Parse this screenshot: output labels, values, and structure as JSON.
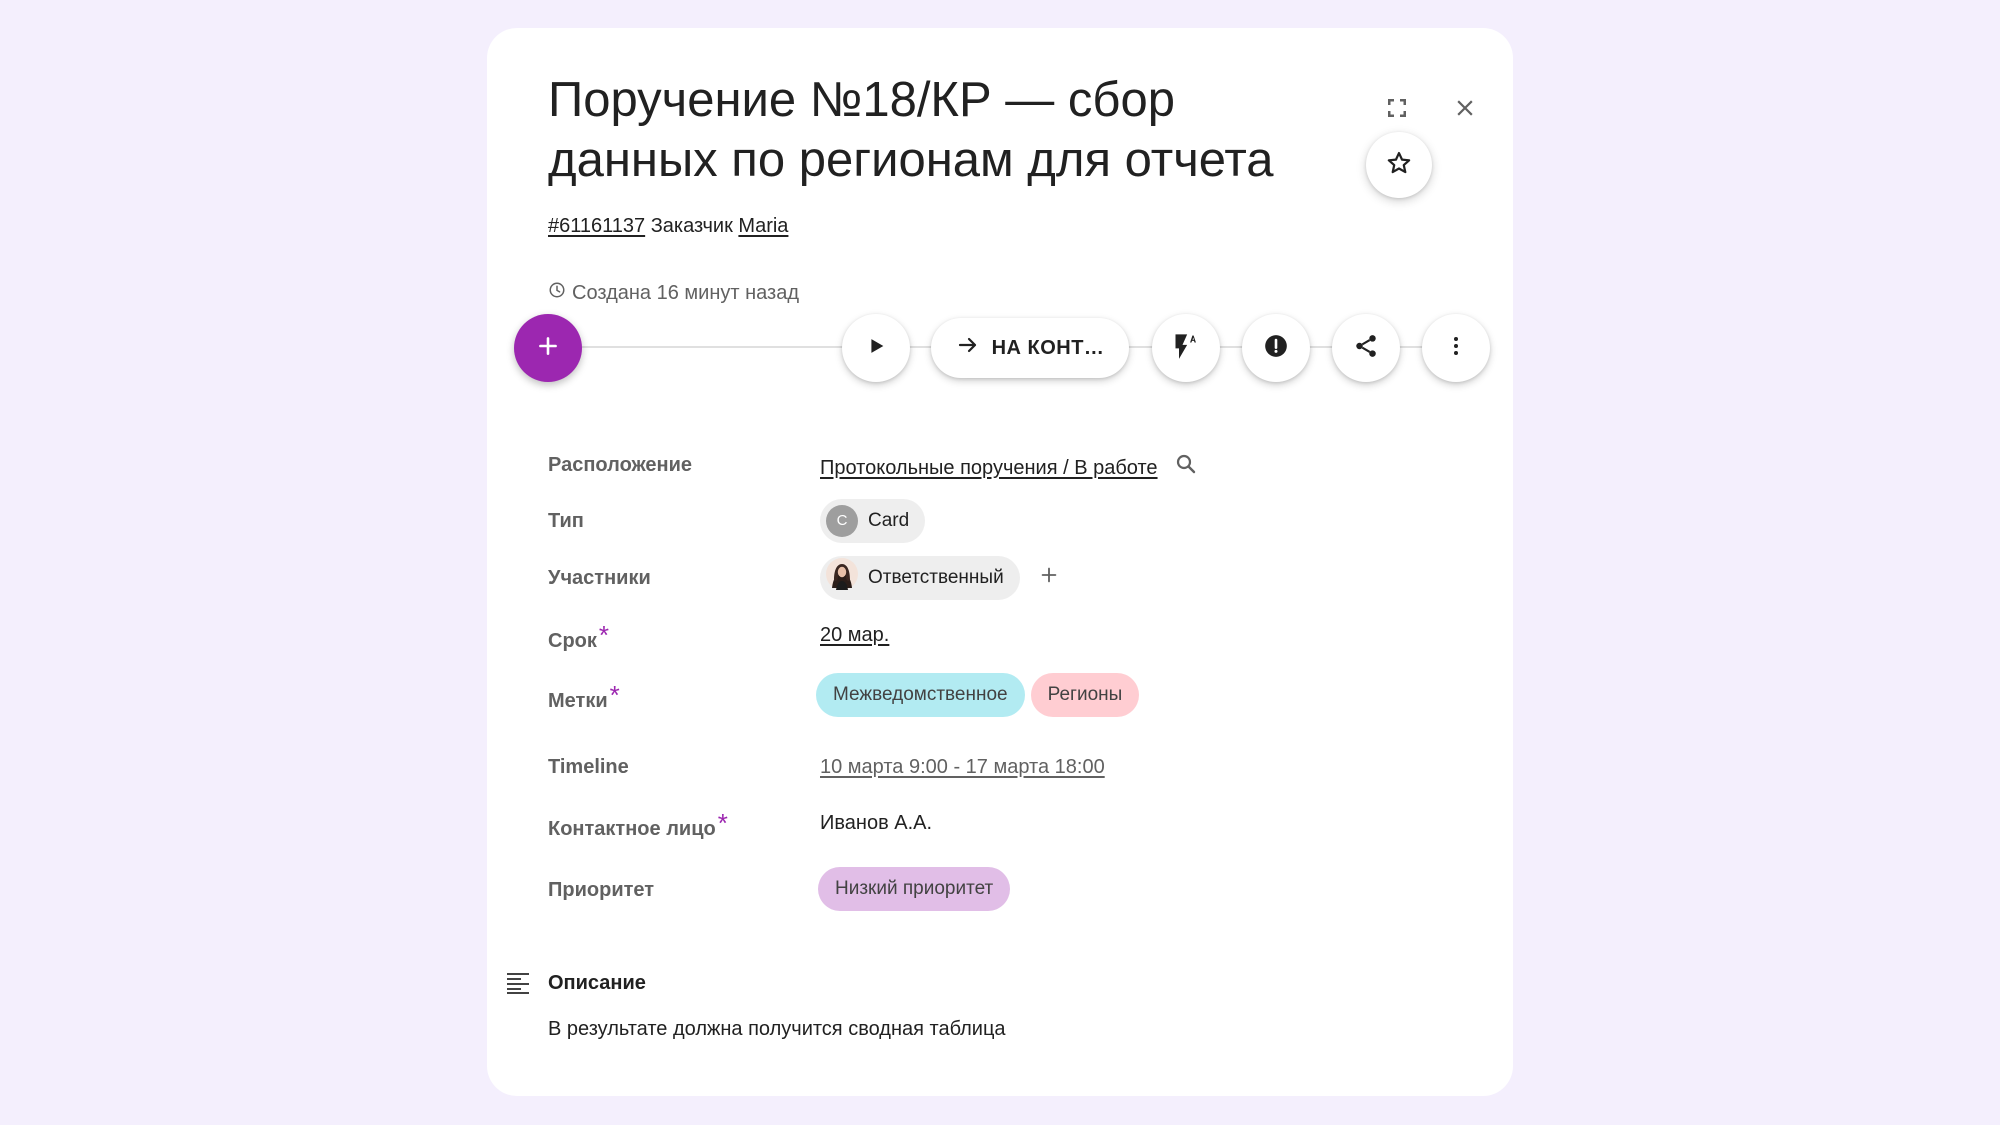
{
  "task": {
    "title": "Поручение №18/КР — сбор данных по регионам для отчета",
    "id": "#61161137",
    "customer_label": "Заказчик",
    "customer_name": "Maria",
    "created": "Создана 16 минут назад"
  },
  "toolbar": {
    "move_label": "НА КОНТ…"
  },
  "fields": {
    "location": {
      "label": "Расположение",
      "value": "Протокольные поручения / В работе"
    },
    "type": {
      "label": "Тип",
      "avatar_letter": "C",
      "value": "Card"
    },
    "participants": {
      "label": "Участники",
      "value": "Ответственный"
    },
    "deadline": {
      "label": "Срок",
      "required_mark": "*",
      "value": "20 мар."
    },
    "tags": {
      "label": "Метки",
      "required_mark": "*",
      "items": [
        {
          "label": "Межведомственное",
          "color": "#b2ebf2"
        },
        {
          "label": "Регионы",
          "color": "#ffcdd2"
        }
      ]
    },
    "timeline": {
      "label": "Timeline",
      "value": "10 марта 9:00 - 17 марта 18:00"
    },
    "contact": {
      "label": "Контактное лицо",
      "required_mark": "*",
      "value": "Иванов А.А."
    },
    "priority": {
      "label": "Приоритет",
      "value": "Низкий приоритет",
      "color": "#e1bee7"
    }
  },
  "description": {
    "title": "Описание",
    "text": "В результате должна получится сводная таблица"
  },
  "colors": {
    "accent": "#9c27b0",
    "background": "#f4effd"
  },
  "icons": [
    "expand-icon",
    "close-icon",
    "star-icon",
    "plus-icon",
    "play-icon",
    "arrow-right-icon",
    "flash-auto-icon",
    "alert-icon",
    "share-icon",
    "more-vert-icon",
    "search-icon",
    "clock-icon",
    "description-icon"
  ]
}
